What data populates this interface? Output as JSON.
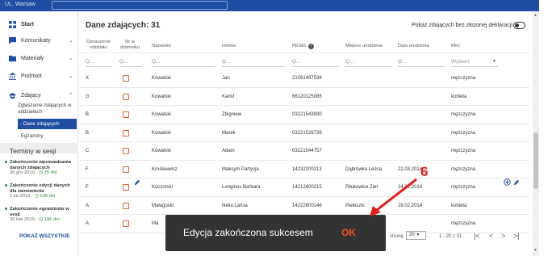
{
  "topbar": {
    "left_text": "UL. Warsaw",
    "search_placeholder": ""
  },
  "sidebar": {
    "items": [
      {
        "label": "Start",
        "icon": "dashboard-icon"
      },
      {
        "label": "Komunikaty",
        "icon": "message-icon"
      },
      {
        "label": "Materiały",
        "icon": "folder-icon"
      },
      {
        "label": "Podmiot",
        "icon": "institution-icon"
      },
      {
        "label": "Zdający",
        "icon": "graduation-cap-icon"
      }
    ],
    "subitems": [
      "Zgłaszanie zdających w oddziałach",
      "- Dane zdających",
      "- Egzaminy"
    ],
    "terms_title": "Terminy w sesji",
    "terms": [
      {
        "title": "Zakończenie wprowadzania danych zdających",
        "date": "30 gru 2019 - ",
        "days": "75 dni"
      },
      {
        "title": "Zakończenie edycji danych dla zamówienia",
        "date": "1 lut 2019 - ",
        "days": "108 dni"
      },
      {
        "title": "Zakończenie egzaminów w sesji",
        "date": "30 kwi 2019 - ",
        "days": "196 dni"
      }
    ],
    "show_all": "POKAŻ WSZYSTKIE"
  },
  "main": {
    "title": "Dane zdających: 31",
    "toggle_label": "Pokaż zdających bez złożonej deklaracji",
    "headers": {
      "oddzial": "Oznaczenie oddziału",
      "nr": "Nr w dzienniku",
      "nazwisko": "Nazwisko",
      "imiona": "Imiona",
      "pesel": "PESEL",
      "miejsce": "Miejsce urodzenia",
      "data": "Data urodzenia",
      "plec": "Płeć"
    },
    "filters": {
      "placeholder": "Q...",
      "plec_placeholder": "Wybierz"
    },
    "rows": [
      {
        "oddzial": "X",
        "nazwisko": "Kowalski",
        "imiona": "Jan",
        "pesel": "21091487538",
        "miejsce": "",
        "data": "",
        "plec": "mężczyzna"
      },
      {
        "oddzial": "G",
        "nazwisko": "Kowalski",
        "imiona": "Kamil",
        "pesel": "66120125085",
        "miejsce": "",
        "data": "",
        "plec": "kobieta"
      },
      {
        "oddzial": "B",
        "nazwisko": "Kowalski",
        "imiona": "Zbigniew",
        "pesel": "03221543930",
        "miejsce": "",
        "data": "",
        "plec": "mężczyzna"
      },
      {
        "oddzial": "B",
        "nazwisko": "Kowalski",
        "imiona": "Marek",
        "pesel": "03221526739",
        "miejsce": "",
        "data": "",
        "plec": "mężczyzna"
      },
      {
        "oddzial": "C",
        "nazwisko": "Kowalski",
        "imiona": "Adam",
        "pesel": "03221544757",
        "miejsce": "",
        "data": "",
        "plec": "mężczyzna"
      },
      {
        "oddzial": "F",
        "nazwisko": "Krośkiewicz",
        "imiona": "Maksym Partycja",
        "pesel": "14232200213",
        "miejsce": "Dąbrówka Leśna",
        "data": "22.03.2014",
        "plec": "mężczyzna"
      },
      {
        "oddzial": "F",
        "nazwisko": "Kuczorski",
        "imiona": "Longinus Barbara",
        "pesel": "14212400215",
        "miejsce": "Piłukowice Zerr",
        "data": "24.02.2014",
        "plec": "mężczyzna"
      },
      {
        "oddzial": "A",
        "nazwisko": "Małagocki",
        "imiona": "Nelia Larisa",
        "pesel": "14222800146",
        "miejsce": "Pieleszki",
        "data": "28.02.2014",
        "plec": "kobieta"
      },
      {
        "oddzial": "A",
        "nazwisko": "Ma",
        "imiona": "",
        "pesel": "",
        "miejsce": "",
        "data": "",
        "plec": "mężczyzna"
      }
    ],
    "pager": {
      "per_page_label": "stronę",
      "per_page": "20",
      "range": "1 - 20 z 31"
    }
  },
  "snackbar": {
    "message": "Edycja zakończona sukcesem",
    "action": "OK"
  },
  "annotation": {
    "number": "6",
    "color": "#e02020"
  }
}
